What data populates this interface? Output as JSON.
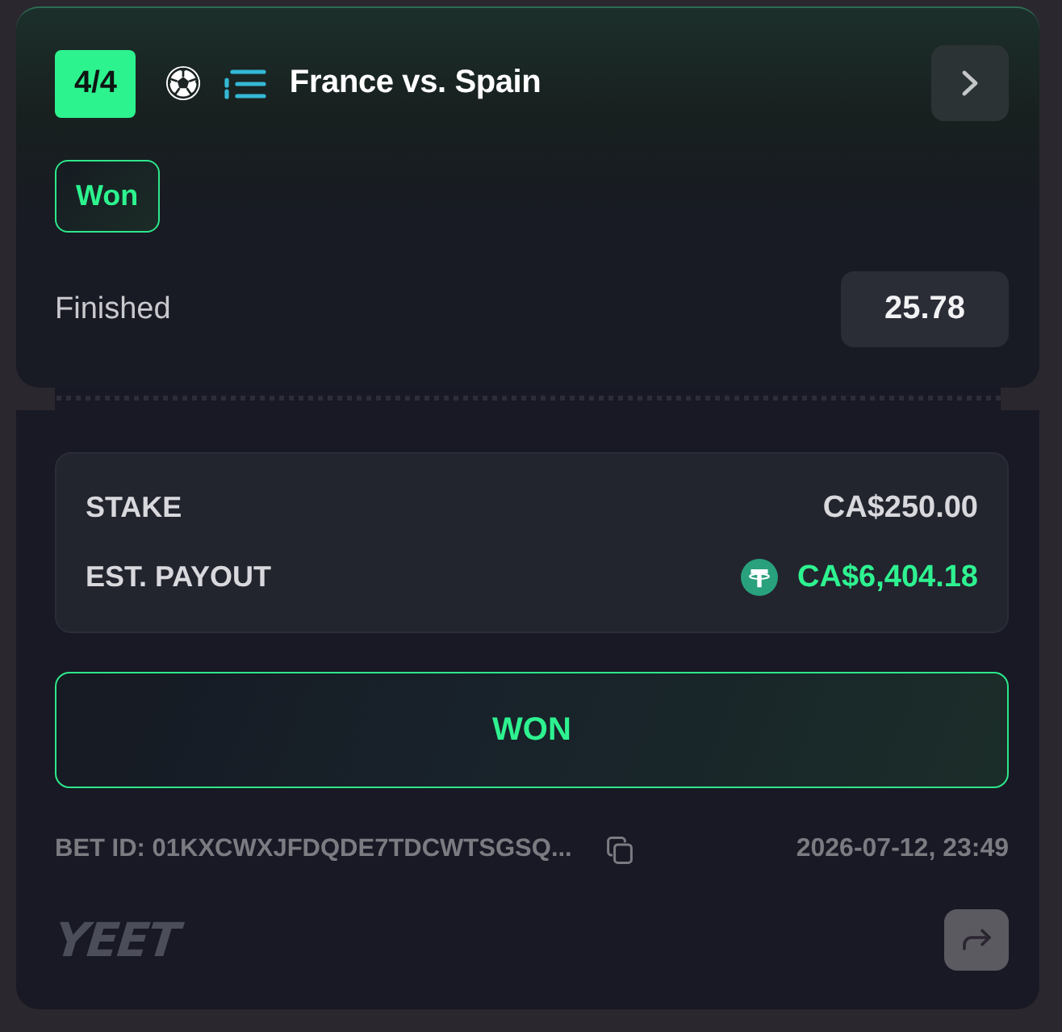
{
  "header": {
    "leg_count": "4/4",
    "title": "France vs. Spain",
    "result_tag": "Won",
    "status": "Finished",
    "odds": "25.78"
  },
  "amounts": [
    {
      "kind": "plain",
      "label": "STAKE",
      "value": "CA$250.00"
    },
    {
      "kind": "payout",
      "label": "EST. PAYOUT",
      "value": "CA$6,404.18"
    }
  ],
  "result_banner": "WON",
  "footer": {
    "bet_id": "BET ID: 01KXCWXJFDQDE7TDCWTSGSQ...",
    "placed_at": "2026-07-12, 23:49",
    "logo": "YEET"
  }
}
